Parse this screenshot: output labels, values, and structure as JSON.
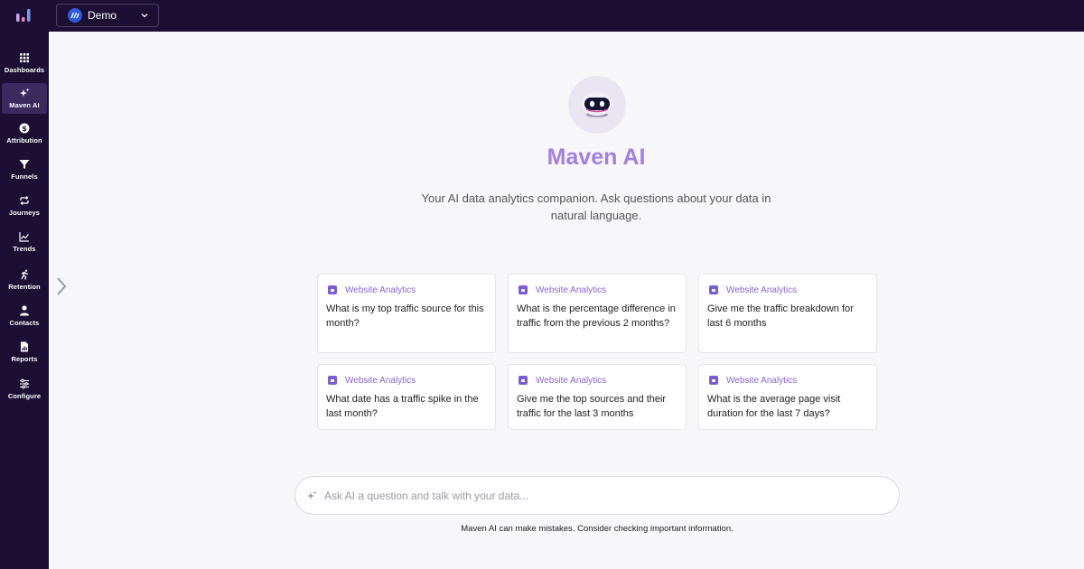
{
  "app": {
    "workspace_name": "Demo",
    "colors": {
      "sidebar_bg": "#1c0f33",
      "accent": "#a180e0",
      "tag": "#8a63d2"
    }
  },
  "sidebar": {
    "items": [
      {
        "label": "Dashboards",
        "icon": "grid-icon"
      },
      {
        "label": "Maven AI",
        "icon": "sparkle-icon",
        "active": true
      },
      {
        "label": "Attribution",
        "icon": "dollar-icon"
      },
      {
        "label": "Funnels",
        "icon": "funnel-icon"
      },
      {
        "label": "Journeys",
        "icon": "journey-icon"
      },
      {
        "label": "Trends",
        "icon": "trend-icon"
      },
      {
        "label": "Retention",
        "icon": "run-icon"
      },
      {
        "label": "Contacts",
        "icon": "person-icon"
      },
      {
        "label": "Reports",
        "icon": "report-icon"
      },
      {
        "label": "Configure",
        "icon": "sliders-icon"
      }
    ]
  },
  "main": {
    "title": "Maven AI",
    "subtitle": "Your AI data analytics companion. Ask questions about your data in natural language.",
    "suggestions": [
      {
        "tag": "Website Analytics",
        "text": "What is my top traffic source for this month?"
      },
      {
        "tag": "Website Analytics",
        "text": "What is the percentage difference in traffic from the previous 2 months?"
      },
      {
        "tag": "Website Analytics",
        "text": "Give me the traffic breakdown for last 6 months"
      },
      {
        "tag": "Website Analytics",
        "text": "What date has a traffic spike in the last month?"
      },
      {
        "tag": "Website Analytics",
        "text": "Give me the top sources and their traffic for the last 3 months"
      },
      {
        "tag": "Website Analytics",
        "text": "What is the average page visit duration for the last 7 days?"
      }
    ],
    "ask_placeholder": "Ask AI a question and talk with your data...",
    "disclaimer": "Maven AI can make mistakes. Consider checking important information."
  }
}
